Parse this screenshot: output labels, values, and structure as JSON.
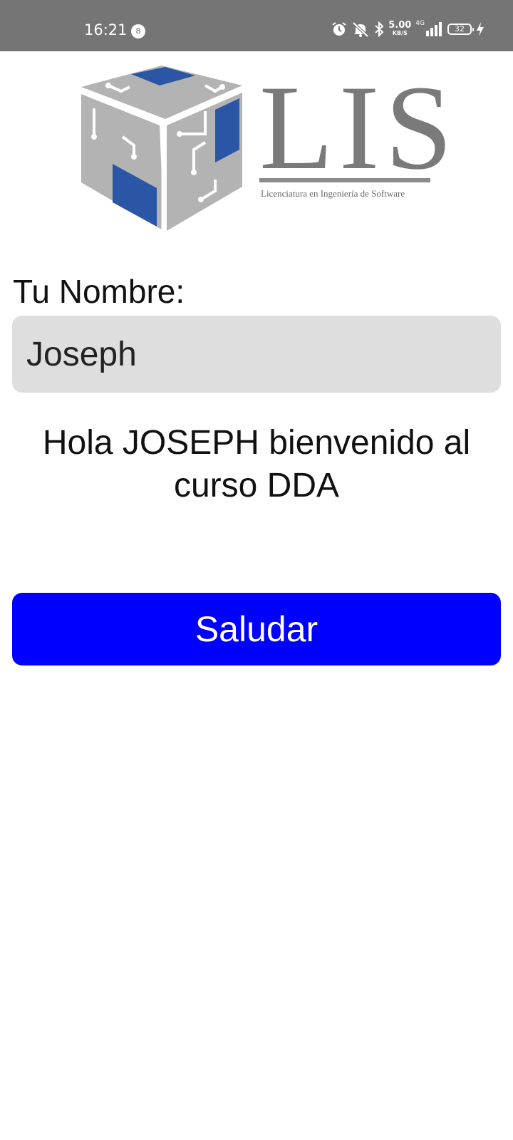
{
  "status_bar": {
    "time": "16:21",
    "notification_count": "8",
    "network_speed": "5.00",
    "network_speed_unit": "KB/S",
    "network_type": "4G",
    "battery_level": "32",
    "icons": [
      "alarm-icon",
      "mute-icon",
      "bluetooth-icon",
      "signal-icon",
      "battery-icon",
      "charging-icon"
    ]
  },
  "logo": {
    "letters": "LIS",
    "subtitle": "Licenciatura en Ingeniería de Software",
    "colors": {
      "gray": "#b3b3b3",
      "blue": "#2b55a5",
      "text": "#7a7a7a"
    }
  },
  "form": {
    "name_label": "Tu Nombre:",
    "name_value": "Joseph"
  },
  "greeting": "Hola JOSEPH bienvenido al curso DDA",
  "button": {
    "label": "Saludar",
    "color": "#0000ff"
  }
}
